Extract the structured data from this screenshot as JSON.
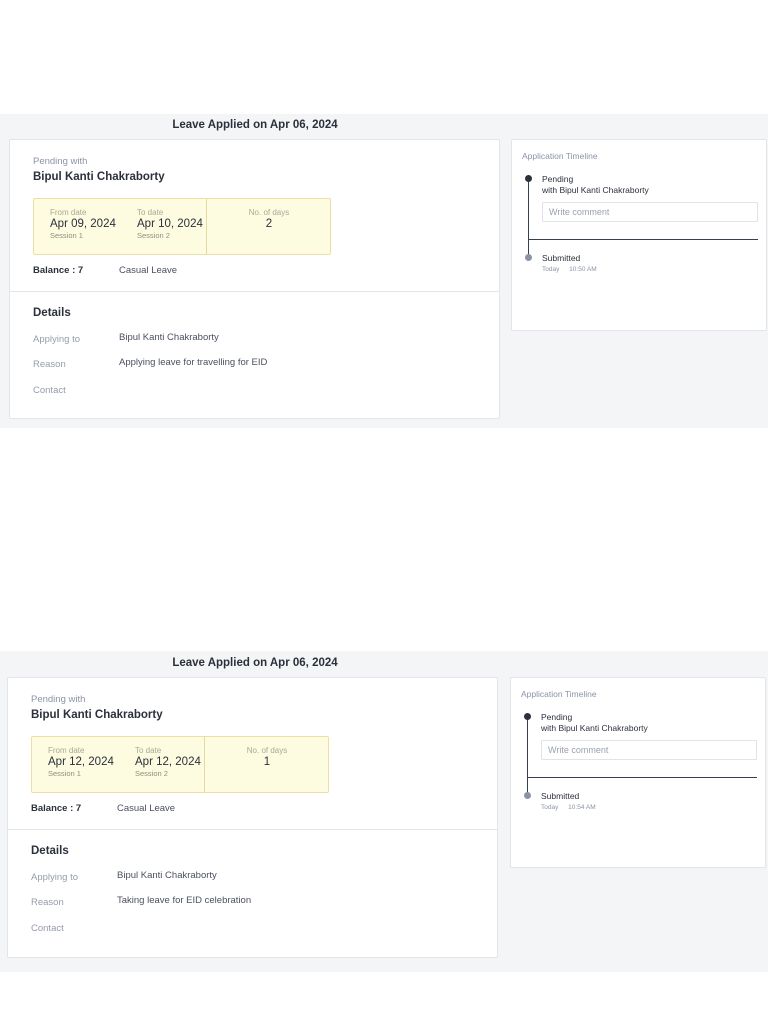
{
  "applications": [
    {
      "heading": "Leave Applied on Apr 06, 2024",
      "pending_label": "Pending with",
      "pending_name": "Bipul Kanti Chakraborty",
      "from_label": "From date",
      "from_date": "Apr 09, 2024",
      "from_session": "Session 1",
      "to_label": "To date",
      "to_date": "Apr 10, 2024",
      "to_session": "Session 2",
      "days_label": "No. of days",
      "days": "2",
      "balance": "Balance : 7",
      "leave_type": "Casual Leave",
      "details_title": "Details",
      "applying_to_label": "Applying to",
      "applying_to": "Bipul Kanti Chakraborty",
      "reason_label": "Reason",
      "reason": "Applying leave for travelling for EID",
      "contact_label": "Contact",
      "contact": "",
      "timeline": {
        "title": "Application Timeline",
        "pending_status": "Pending",
        "pending_with": "with Bipul Kanti Chakraborty",
        "comment_placeholder": "Write comment",
        "submitted_status": "Submitted",
        "submitted_day": "Today",
        "submitted_time": "10:50 AM"
      }
    },
    {
      "heading": "Leave Applied on Apr 06, 2024",
      "pending_label": "Pending with",
      "pending_name": "Bipul Kanti Chakraborty",
      "from_label": "From date",
      "from_date": "Apr 12, 2024",
      "from_session": "Session 1",
      "to_label": "To date",
      "to_date": "Apr 12, 2024",
      "to_session": "Session 2",
      "days_label": "No. of days",
      "days": "1",
      "balance": "Balance : 7",
      "leave_type": "Casual Leave",
      "details_title": "Details",
      "applying_to_label": "Applying to",
      "applying_to": "Bipul Kanti Chakraborty",
      "reason_label": "Reason",
      "reason": "Taking leave for EID celebration",
      "contact_label": "Contact",
      "contact": "",
      "timeline": {
        "title": "Application Timeline",
        "pending_status": "Pending",
        "pending_with": "with Bipul Kanti Chakraborty",
        "comment_placeholder": "Write comment",
        "submitted_status": "Submitted",
        "submitted_day": "Today",
        "submitted_time": "10:54 AM"
      }
    }
  ]
}
